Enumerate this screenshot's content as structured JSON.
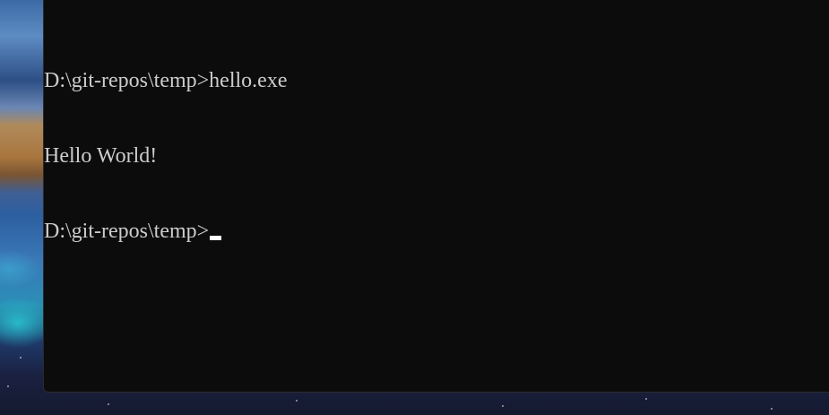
{
  "console": {
    "lines": [
      "D:\\git-repos\\temp>hello.exe",
      "Hello World!",
      "D:\\git-repos\\temp>"
    ],
    "text_color": "#cccccc",
    "background_color": "#0c0c0c",
    "cursor_color": "#ffffff"
  }
}
